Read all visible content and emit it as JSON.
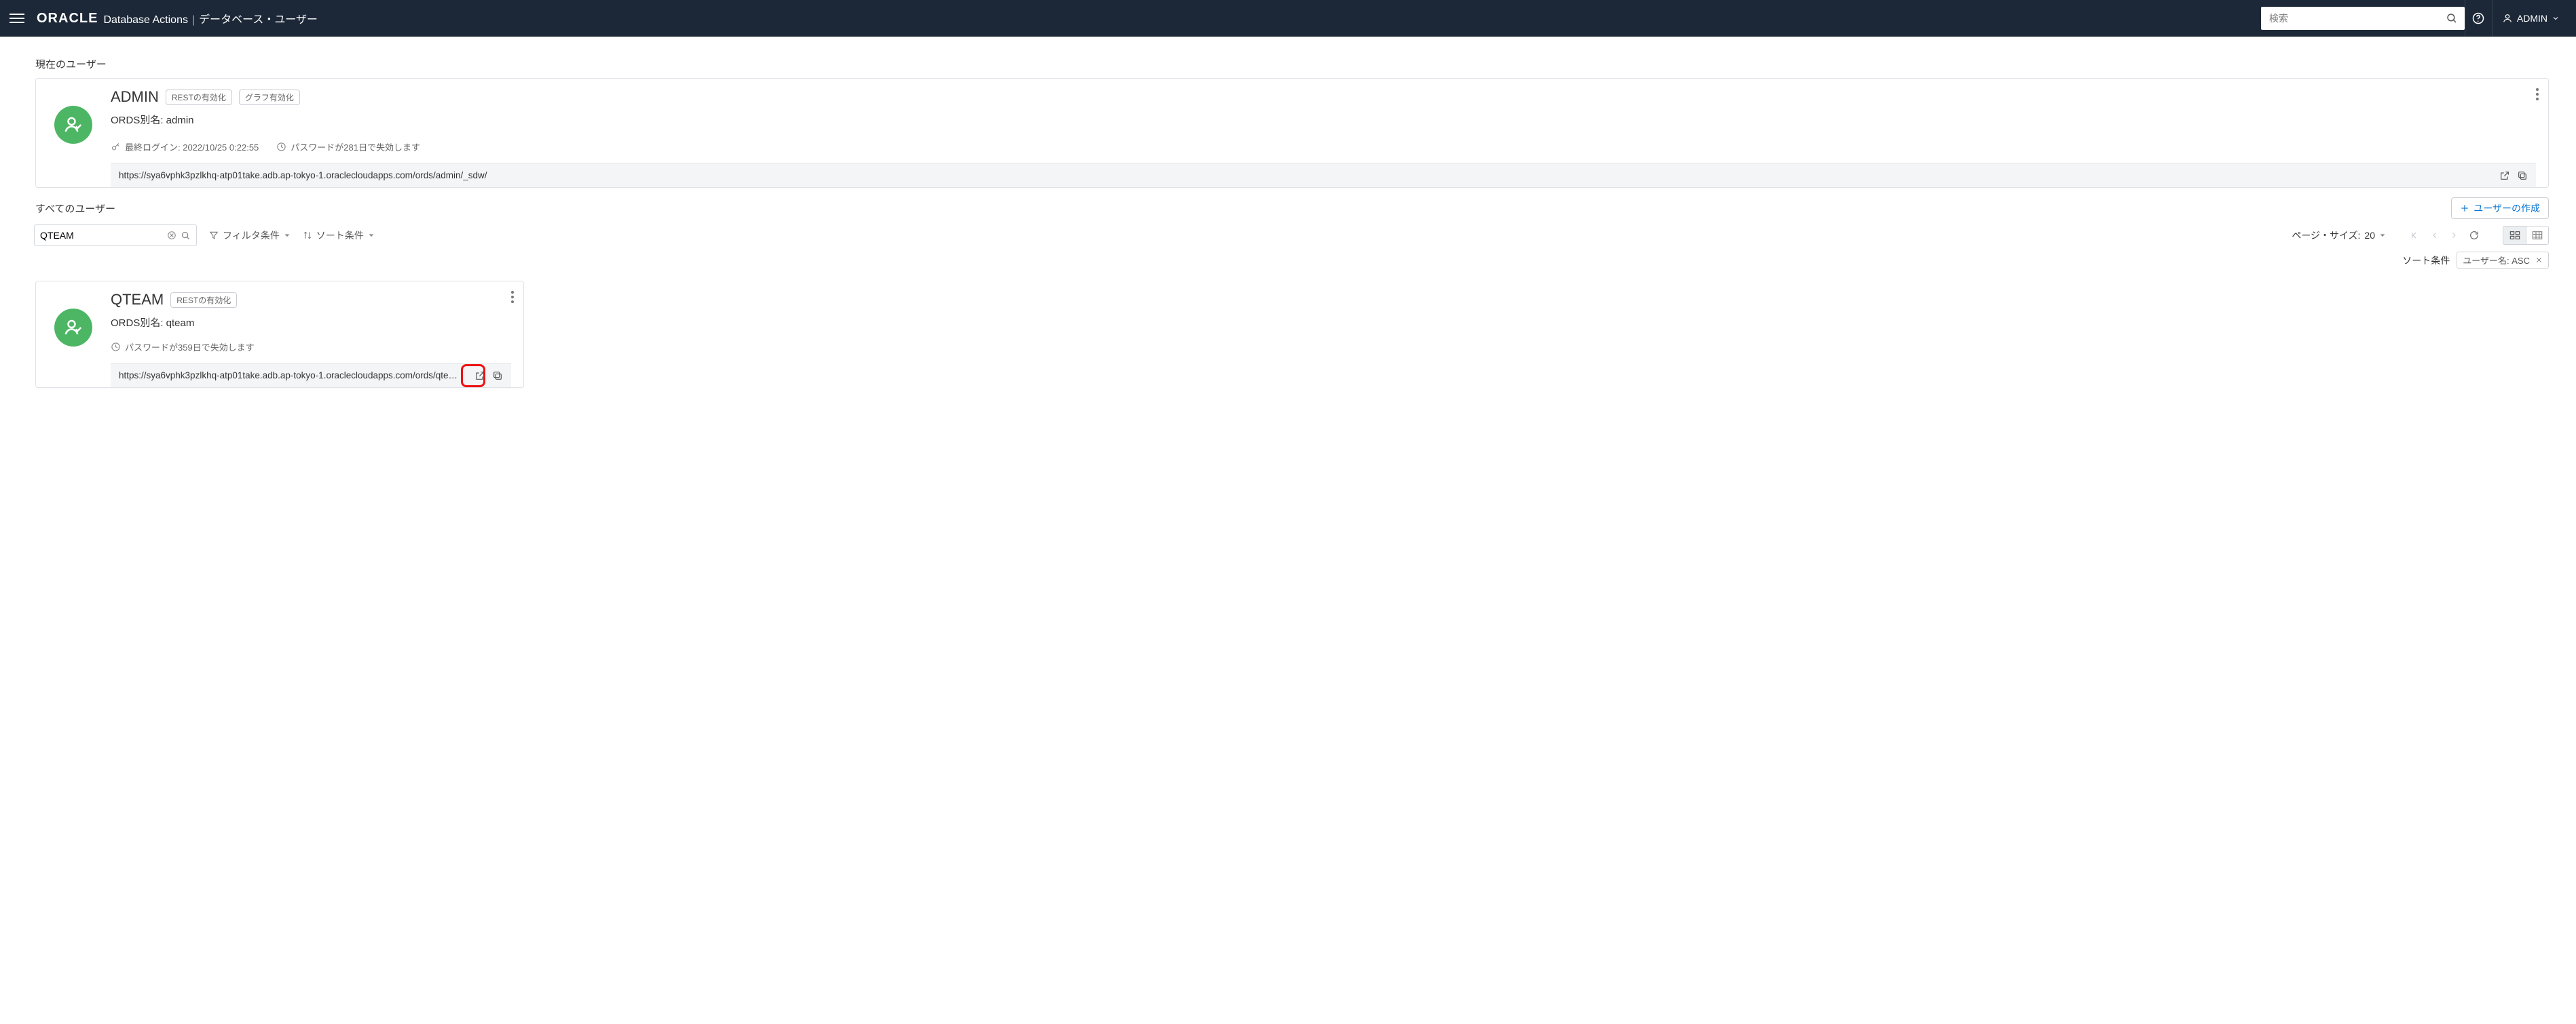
{
  "header": {
    "logo_text": "ORACLE",
    "app_name": "Database Actions",
    "page_title": "データベース・ユーザー",
    "search_placeholder": "検索",
    "current_user": "ADMIN"
  },
  "sections": {
    "current_user_label": "現在のユーザー",
    "all_users_label": "すべてのユーザー",
    "create_user_label": "ユーザーの作成"
  },
  "current_user_card": {
    "name": "ADMIN",
    "rest_enable_label": "RESTの有効化",
    "graph_enable_label": "グラフ有効化",
    "ords_alias_label": "ORDS別名: admin",
    "last_login_label": "最終ログイン: 2022/10/25 0:22:55",
    "pwd_expire_label": "パスワードが281日で失効します",
    "url": "https://sya6vphk3pzlkhq-atp01take.adb.ap-tokyo-1.oraclecloudapps.com/ords/admin/_sdw/"
  },
  "toolbar": {
    "filter_value": "QTEAM",
    "filter_label": "フィルタ条件",
    "sort_label": "ソート条件",
    "page_size_label": "ページ・サイズ:",
    "page_size_value": "20",
    "sort_chip_prefix": "ソート条件",
    "sort_chip_value": "ユーザー名: ASC"
  },
  "user_card": {
    "name": "QTEAM",
    "rest_enable_label": "RESTの有効化",
    "ords_alias_label": "ORDS別名: qteam",
    "pwd_expire_label": "パスワードが359日で失効します",
    "url": "https://sya6vphk3pzlkhq-atp01take.adb.ap-tokyo-1.oraclecloudapps.com/ords/qte…"
  }
}
